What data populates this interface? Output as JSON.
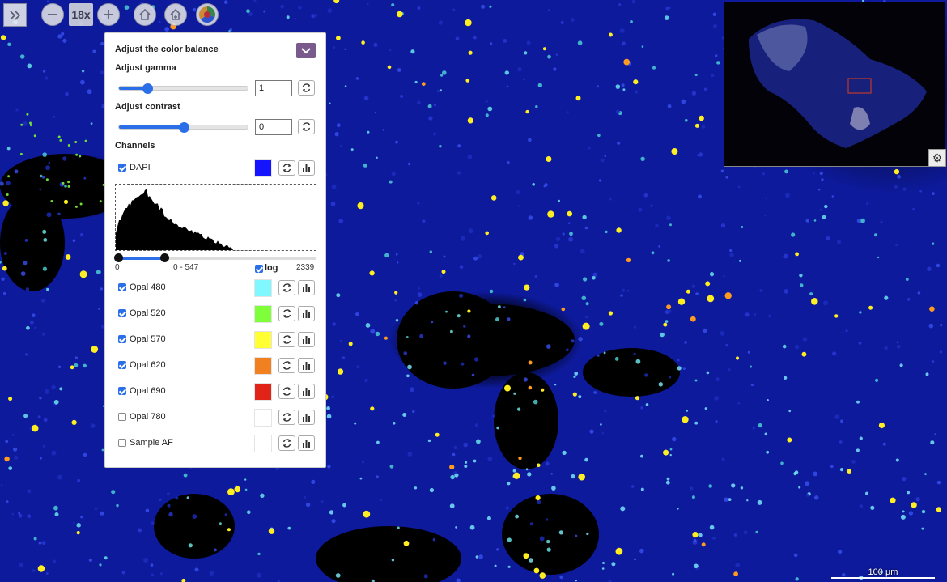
{
  "toolbar": {
    "expand_icon": "double-chevron-right-icon",
    "zoom_out_icon": "minus-icon",
    "zoom_level": "18x",
    "zoom_in_icon": "plus-icon",
    "home_icon": "home-icon",
    "fit_icon": "fit-icon",
    "color_icon": "color-wheel-icon"
  },
  "panel": {
    "title": "Adjust the color balance",
    "gamma_label": "Adjust gamma",
    "gamma_value": "1",
    "gamma_slider_fraction": 0.22,
    "contrast_label": "Adjust contrast",
    "contrast_value": "0",
    "contrast_slider_fraction": 0.5,
    "channels_label": "Channels",
    "histogram": {
      "range_min": "0",
      "range_label": "0 - 547",
      "range_max": "2339",
      "log_label": "log",
      "log_checked": true,
      "selected_low": 0,
      "selected_high": 547,
      "max": 2339
    },
    "channels": [
      {
        "name": "DAPI",
        "checked": true,
        "color": "#1414ff"
      },
      {
        "name": "Opal 480",
        "checked": true,
        "color": "#7ff8ff"
      },
      {
        "name": "Opal 520",
        "checked": true,
        "color": "#7fff3a"
      },
      {
        "name": "Opal 570",
        "checked": true,
        "color": "#ffff33"
      },
      {
        "name": "Opal 620",
        "checked": true,
        "color": "#f08020"
      },
      {
        "name": "Opal 690",
        "checked": true,
        "color": "#e02418"
      },
      {
        "name": "Opal 780",
        "checked": false,
        "color": "#ffffff"
      },
      {
        "name": "Sample AF",
        "checked": false,
        "color": "#ffffff"
      }
    ]
  },
  "minimap": {
    "settings_icon": "gear-icon"
  },
  "scalebar": {
    "label": "100 µm"
  }
}
